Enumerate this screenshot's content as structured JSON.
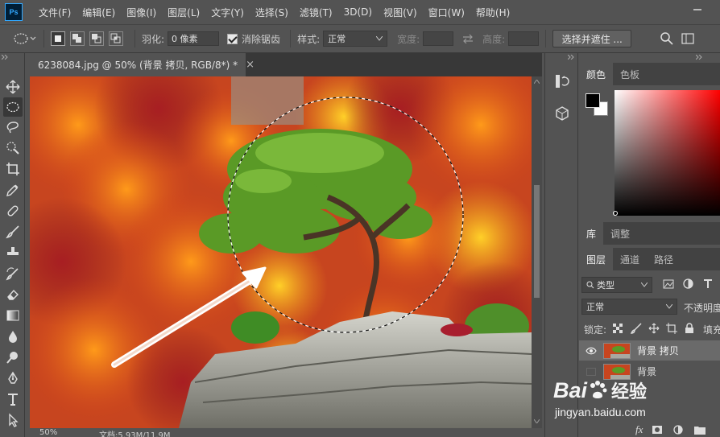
{
  "app": {
    "logo": "Ps",
    "menu": [
      "文件(F)",
      "编辑(E)",
      "图像(I)",
      "图层(L)",
      "文字(Y)",
      "选择(S)",
      "滤镜(T)",
      "3D(D)",
      "视图(V)",
      "窗口(W)",
      "帮助(H)"
    ]
  },
  "options": {
    "feather_label": "羽化:",
    "feather_value": "0 像素",
    "antialias_label": "消除锯齿",
    "style_label": "样式:",
    "style_value": "正常",
    "width_label": "宽度:",
    "height_label": "高度:",
    "select_mask_label": "选择并遮住 ..."
  },
  "document": {
    "tab_title": "6238084.jpg @ 50% (背景 拷贝, RGB/8*) *",
    "close_glyph": "×",
    "zoom": "50%",
    "doc_info": "文档:5.93M/11.9M"
  },
  "panels": {
    "color_tabs": [
      "颜色",
      "色板"
    ],
    "library_tabs": [
      "库",
      "调整"
    ],
    "layers_tabs": [
      "图层",
      "通道",
      "路径"
    ],
    "filter_kind": "类型",
    "blend_mode": "正常",
    "opacity_label": "不透明度",
    "lock_label": "锁定:",
    "fill_label": "填充",
    "layers": [
      {
        "name": "背景 拷贝",
        "visible": true,
        "selected": true
      },
      {
        "name": "背景",
        "visible": false,
        "selected": false
      }
    ],
    "footer_fx": "fx"
  },
  "watermark": {
    "brand": "Bai",
    "brand_cn": "经验",
    "url": "jingyan.baidu.com"
  },
  "colors": {
    "foreground": "#000000",
    "background": "#ffffff",
    "accent_red": "#ff0000"
  }
}
